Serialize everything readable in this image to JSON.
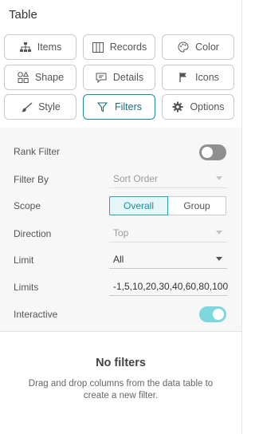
{
  "panel": {
    "title": "Table"
  },
  "buttons": [
    {
      "label": "Items",
      "icon": "hierarchy-icon"
    },
    {
      "label": "Records",
      "icon": "columns-icon"
    },
    {
      "label": "Color",
      "icon": "palette-icon"
    },
    {
      "label": "Shape",
      "icon": "shapes-icon"
    },
    {
      "label": "Details",
      "icon": "comment-icon"
    },
    {
      "label": "Icons",
      "icon": "flag-icon"
    },
    {
      "label": "Style",
      "icon": "brush-icon"
    },
    {
      "label": "Filters",
      "icon": "filter-icon",
      "active": true
    },
    {
      "label": "Options",
      "icon": "gear-icon"
    }
  ],
  "settings": {
    "rank_filter": {
      "label": "Rank Filter",
      "on": false
    },
    "filter_by": {
      "label": "Filter By",
      "value": "Sort Order",
      "enabled": false
    },
    "scope": {
      "label": "Scope",
      "options": [
        "Overall",
        "Group"
      ],
      "selected": "Overall"
    },
    "direction": {
      "label": "Direction",
      "value": "Top",
      "enabled": false
    },
    "limit": {
      "label": "Limit",
      "value": "All"
    },
    "limits": {
      "label": "Limits",
      "value": "-1,5,10,20,30,40,60,80,100"
    },
    "interactive": {
      "label": "Interactive",
      "on": true
    }
  },
  "empty_state": {
    "title": "No filters",
    "description": "Drag and drop columns from the data table to create a new filter."
  },
  "colors": {
    "accent": "#1a8fa0",
    "toggle_on": "#7fd7de",
    "toggle_off": "#8f8f8f",
    "background_settings": "#f7f7f7"
  }
}
